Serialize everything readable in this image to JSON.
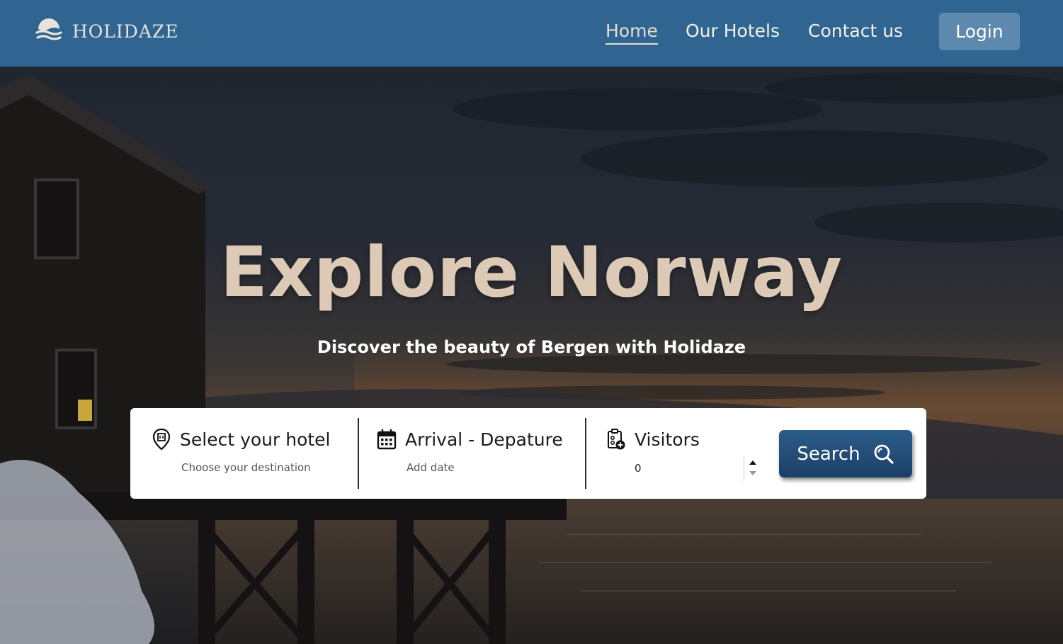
{
  "brand": {
    "name": "HOLIDAZE",
    "logo_icon": "waves-icon"
  },
  "nav": {
    "items": [
      {
        "label": "Home",
        "active": true
      },
      {
        "label": "Our Hotels",
        "active": false
      },
      {
        "label": "Contact us",
        "active": false
      }
    ],
    "login_label": "Login"
  },
  "hero": {
    "title": "Explore Norway",
    "subtitle": "Discover the beauty of Bergen with Holidaze"
  },
  "search": {
    "hotel": {
      "label": "Select your hotel",
      "placeholder": "Choose your destination",
      "icon": "map-pin-icon"
    },
    "dates": {
      "label": "Arrival - Depature",
      "placeholder": "Add date",
      "icon": "calendar-icon"
    },
    "visitors": {
      "label": "Visitors",
      "value": "0",
      "icon": "clipboard-add-icon"
    },
    "button_label": "Search",
    "button_icon": "search-icon"
  },
  "colors": {
    "header_bg": "#2f6590",
    "login_bg": "#5d89ae",
    "title": "#ddcab6",
    "button": "#1f4a75"
  }
}
